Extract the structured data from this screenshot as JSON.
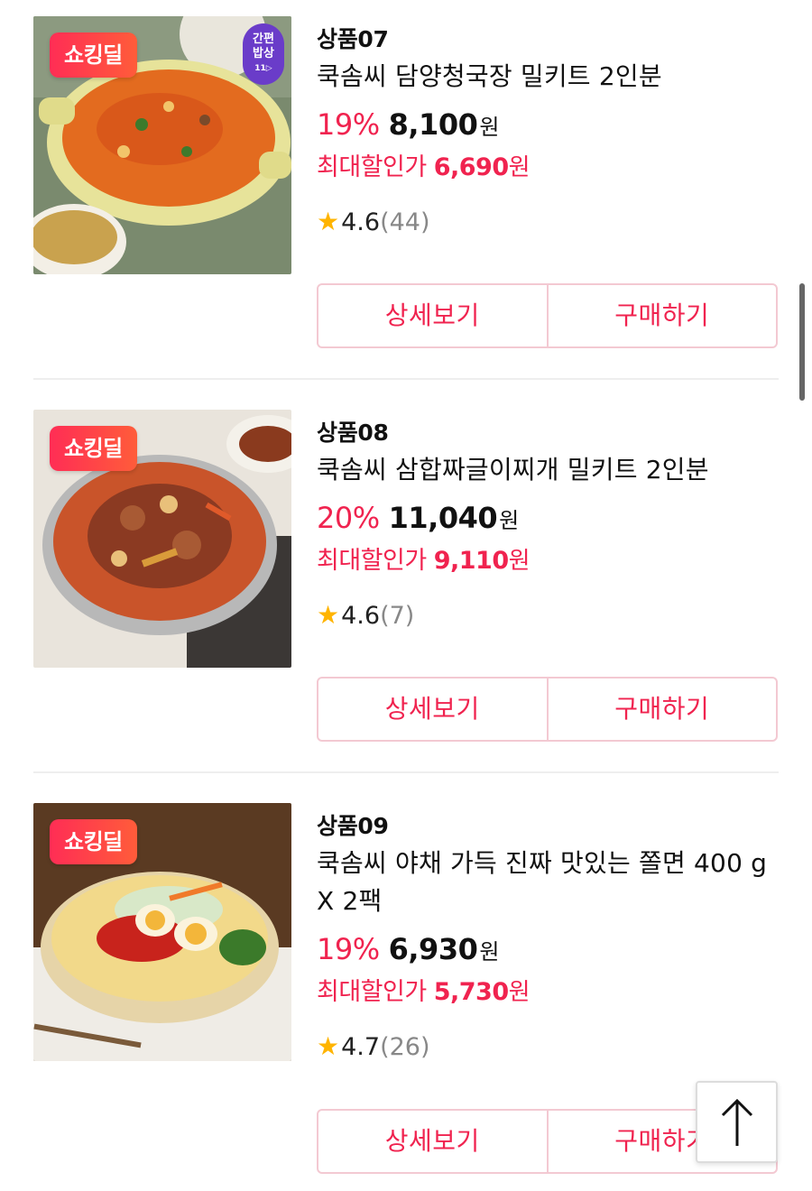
{
  "products": [
    {
      "badge": "쇼킹딜",
      "brand_badge": {
        "line1": "간편",
        "line2": "밥상",
        "line3": "11▷"
      },
      "code": "상품07",
      "name": "쿡솜씨 담양청국장 밀키트 2인분",
      "discount": "19%",
      "price": "8,100",
      "currency": "원",
      "max_label": "최대할인가",
      "max_price": "6,690",
      "rating": "4.6",
      "reviews": "(44)",
      "detail_label": "상세보기",
      "buy_label": "구매하기"
    },
    {
      "badge": "쇼킹딜",
      "code": "상품08",
      "name": "쿡솜씨 삼합짜글이찌개 밀키트 2인분",
      "discount": "20%",
      "price": "11,040",
      "currency": "원",
      "max_label": "최대할인가",
      "max_price": "9,110",
      "rating": "4.6",
      "reviews": "(7)",
      "detail_label": "상세보기",
      "buy_label": "구매하기"
    },
    {
      "badge": "쇼킹딜",
      "code": "상품09",
      "name": "쿡솜씨 야채 가득 진짜 맛있는 쫄면 400 g X 2팩",
      "discount": "19%",
      "price": "6,930",
      "currency": "원",
      "max_label": "최대할인가",
      "max_price": "5,730",
      "rating": "4.7",
      "reviews": "(26)",
      "detail_label": "상세보기",
      "buy_label": "구매하기"
    }
  ],
  "colors": {
    "accent": "#f0234f",
    "star": "#ffb400",
    "button_border": "#f3c9d2"
  },
  "icons": {
    "rating": "star-icon",
    "scroll_top": "arrow-up-icon"
  }
}
